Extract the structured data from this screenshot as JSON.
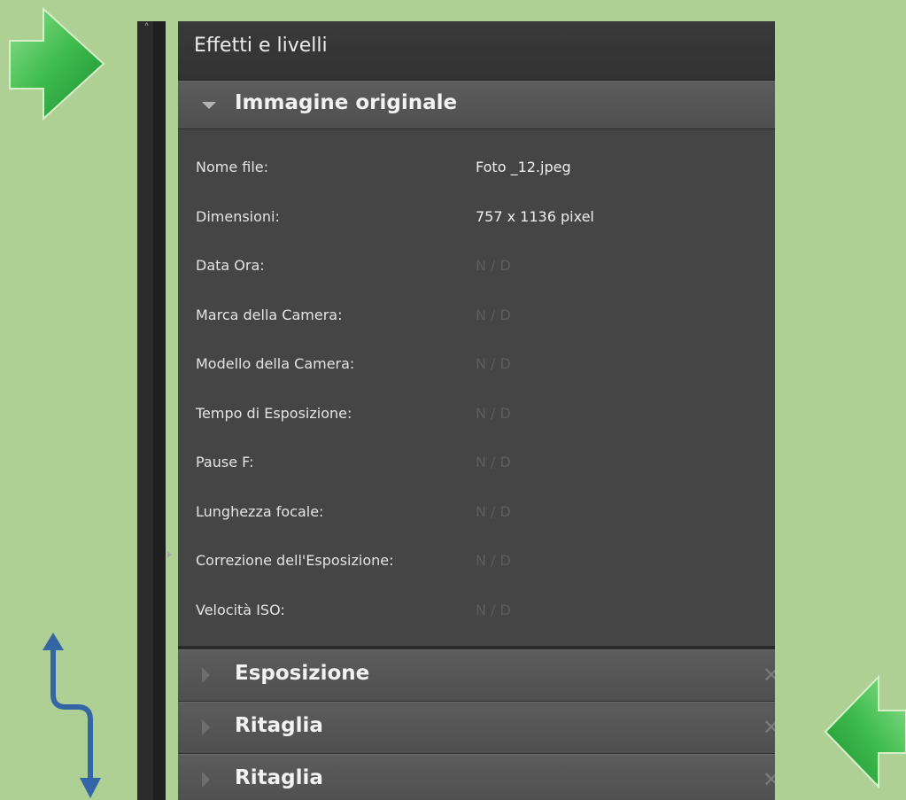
{
  "panel": {
    "title": "Effetti e livelli"
  },
  "sections": {
    "original": {
      "title": "Immagine originale"
    },
    "exposure": {
      "title": "Esposizione"
    },
    "crop1": {
      "title": "Ritaglia"
    },
    "crop2": {
      "title": "Ritaglia"
    }
  },
  "details": [
    {
      "label": "Nome file:",
      "value": "Foto _12.jpeg",
      "na": false
    },
    {
      "label": "Dimensioni:",
      "value": "757 x 1136 pixel",
      "na": false
    },
    {
      "label": "Data Ora:",
      "value": "N / D",
      "na": true
    },
    {
      "label": "Marca della Camera:",
      "value": "N / D",
      "na": true
    },
    {
      "label": "Modello della Camera:",
      "value": "N / D",
      "na": true
    },
    {
      "label": "Tempo di Esposizione:",
      "value": "N / D",
      "na": true
    },
    {
      "label": "Pause F:",
      "value": "N / D",
      "na": true
    },
    {
      "label": "Lunghezza focale:",
      "value": "N / D",
      "na": true
    },
    {
      "label": "Correzione dell'Esposizione:",
      "value": "N / D",
      "na": true
    },
    {
      "label": "Velocità ISO:",
      "value": "N / D",
      "na": true
    }
  ],
  "icons": {
    "collapse": "chevron-up-icon",
    "expand_side": "triangle-right-icon",
    "section_open": "triangle-down-icon",
    "section_closed": "triangle-right-icon",
    "remove": "close-icon"
  },
  "colors": {
    "background": "#aed095",
    "panel": "#454545",
    "arrow_green": "#3cb44a",
    "arrow_blue": "#3465a4",
    "na_text": "#5e5e5e"
  }
}
